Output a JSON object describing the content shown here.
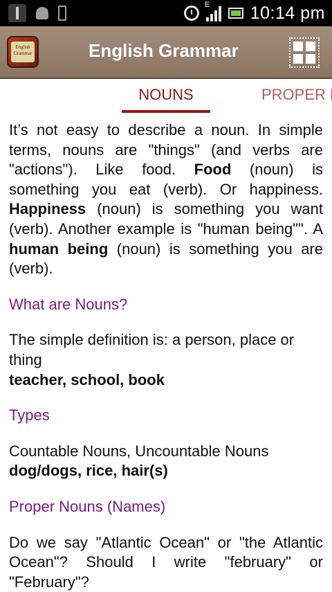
{
  "statusbar": {
    "time": "10:14 pm",
    "network_label": "E"
  },
  "appbar": {
    "title": "English Grammar",
    "icon_text": "English Grammar"
  },
  "tabs": {
    "active": "NOUNS",
    "next": "PROPER N"
  },
  "content": {
    "intro": {
      "t1": "It’s not easy to describe a noun. In simple terms, nouns are \"things\" (and verbs are \"actions\"). Like food. ",
      "b1": "Food",
      "t2": " (noun) is something you eat (verb). Or happiness. ",
      "b2": "Happiness",
      "t3": " (noun) is something you want (verb). Another example is \"human being\"\". A ",
      "b3": "human being",
      "t4": " (noun) is something you are (verb)."
    },
    "section1": {
      "heading": "What are Nouns?",
      "text": "The simple definition is: a person, place or thing",
      "examples": "teacher, school, book"
    },
    "section2": {
      "heading": "Types",
      "text": "Countable Nouns, Uncountable Nouns",
      "examples": "dog/dogs, rice, hair(s)"
    },
    "section3": {
      "heading": "Proper Nouns (Names)",
      "text": "Do we say \"Atlantic Ocean\" or \"the Atlantic Ocean\"? Should I write \"february\" or \"February\"?"
    }
  }
}
